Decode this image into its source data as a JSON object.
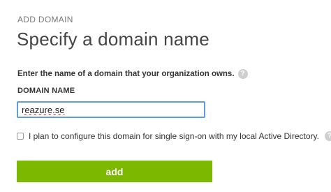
{
  "header": {
    "eyebrow": "ADD DOMAIN",
    "title": "Specify a domain name"
  },
  "form": {
    "instruction": "Enter the name of a domain that your organization owns.",
    "help_icon_glyph": "?",
    "domain_label": "DOMAIN NAME",
    "domain_value": "reazure.se",
    "sso_checkbox_label": "I plan to configure this domain for single sign-on with my local Active Directory.",
    "sso_checked": false,
    "submit_label": "add"
  },
  "colors": {
    "accent_green": "#7cb800",
    "input_focus_border": "#5c9ee0",
    "help_icon_bg": "#cfcfcf"
  },
  "icons": {
    "help": "question-mark-circle-icon"
  }
}
